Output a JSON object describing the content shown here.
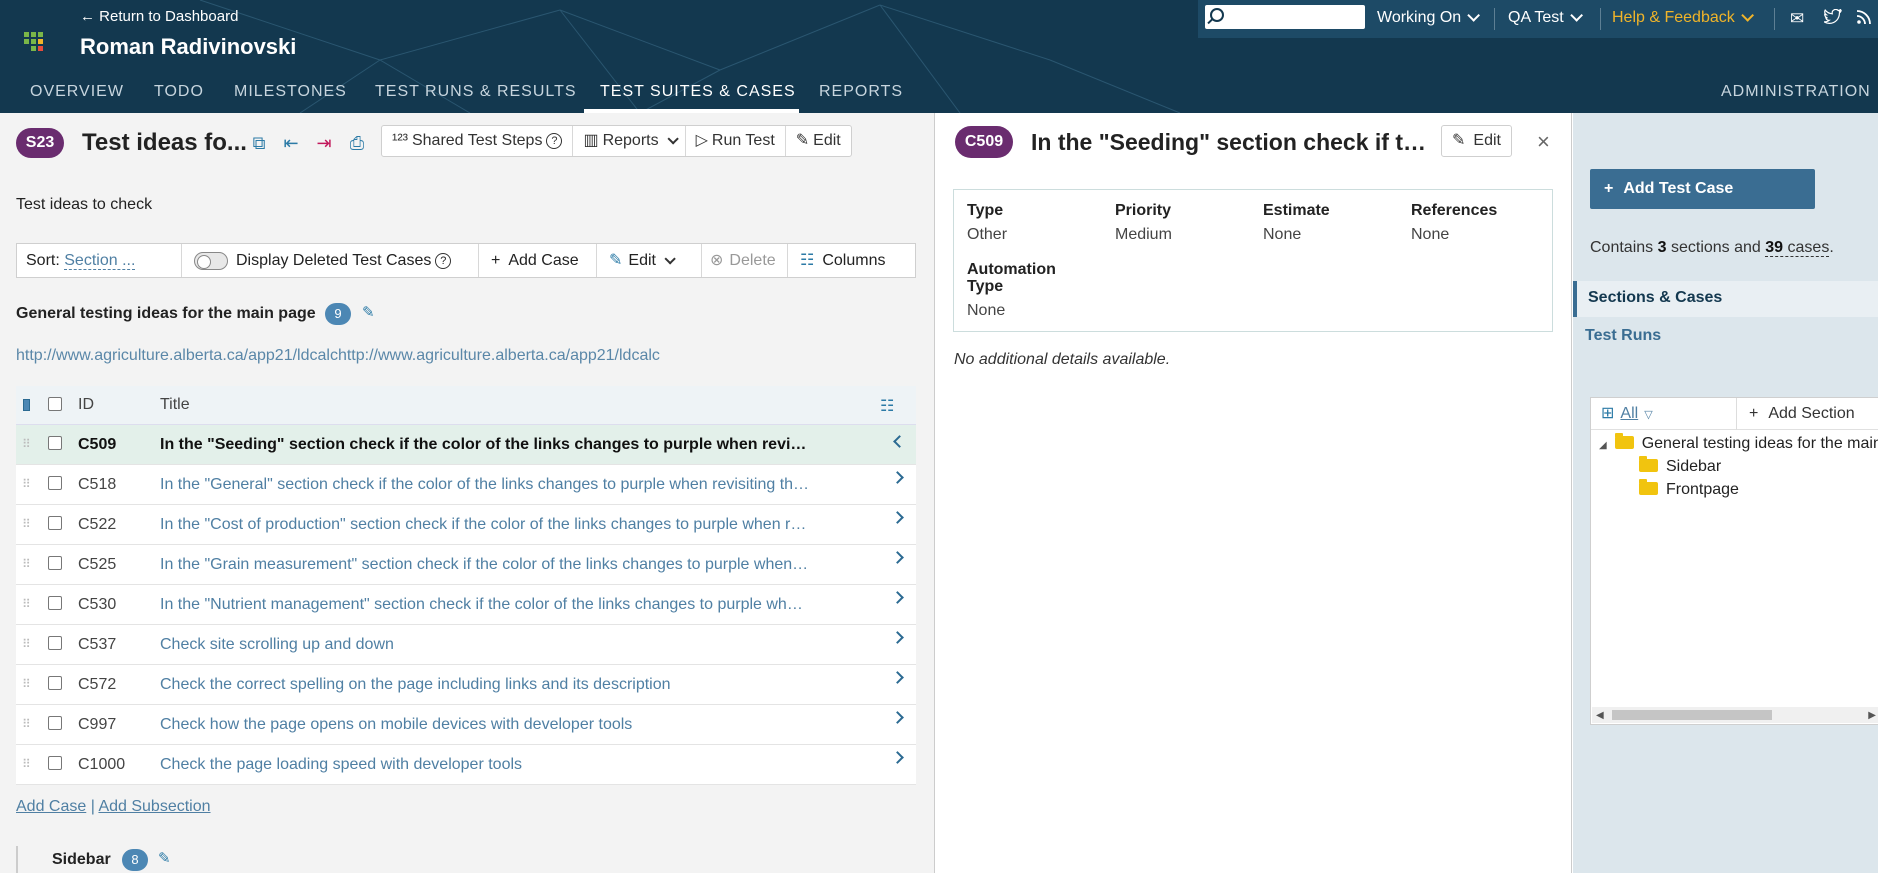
{
  "header": {
    "return_link": "← Return to Dashboard",
    "project_name": "Roman Radivinovski",
    "search_placeholder": "",
    "working_on": "Working On",
    "qa_test": "QA Test",
    "help_feedback": "Help & Feedback",
    "accent_color": "#f0b429",
    "tabs": [
      "OVERVIEW",
      "TODO",
      "MILESTONES",
      "TEST RUNS & RESULTS",
      "TEST SUITES & CASES",
      "REPORTS"
    ],
    "active_tab": "TEST SUITES & CASES",
    "administration": "ADMINISTRATION"
  },
  "suite": {
    "badge": "S23",
    "title": "Test ideas fo...",
    "shared_steps": "Shared Test Steps",
    "reports": "Reports",
    "run_test": "Run Test",
    "edit": "Edit",
    "description": "Test ideas to check",
    "sort_label": "Sort:",
    "sort_value": "Section ...",
    "display_deleted": "Display Deleted Test Cases",
    "add_case": "Add Case",
    "edit_menu": "Edit",
    "delete": "Delete",
    "columns": "Columns"
  },
  "section": {
    "name": "General testing ideas for the main page",
    "count": "9",
    "description": "http://www.agriculture.alberta.ca/app21/ldcalchttp://www.agriculture.alberta.ca/app21/ldcalc",
    "col_id": "ID",
    "col_title": "Title",
    "cases": [
      {
        "id": "C509",
        "title": "In the \"Seeding\" section check if the color of the links changes to purple when revisiting them"
      },
      {
        "id": "C518",
        "title": "In the \"General\" section check if the color of the links changes to purple when revisiting them"
      },
      {
        "id": "C522",
        "title": "In the \"Cost of production\" section check if the color of the links changes to purple when revisiting them"
      },
      {
        "id": "C525",
        "title": "In the \"Grain measurement\" section check if the color of the links changes to purple when revisiting them"
      },
      {
        "id": "C530",
        "title": "In the \"Nutrient management\" section check if the color of the links changes to purple when revisiting them"
      },
      {
        "id": "C537",
        "title": "Check site scrolling up and down"
      },
      {
        "id": "C572",
        "title": "Check the correct spelling on the page including links and its description"
      },
      {
        "id": "C997",
        "title": "Check how the page opens on mobile devices with developer tools"
      },
      {
        "id": "C1000",
        "title": "Check the page loading speed with developer tools"
      }
    ],
    "add_case_link": "Add Case",
    "separator": "|",
    "add_subsection_link": "Add Subsection"
  },
  "subsection": {
    "name": "Sidebar",
    "count": "8"
  },
  "detail": {
    "badge": "C509",
    "title": "In the \"Seeding\" section check if the ...",
    "edit": "Edit",
    "close": "×",
    "type_label": "Type",
    "type_value": "Other",
    "priority_label": "Priority",
    "priority_value": "Medium",
    "estimate_label": "Estimate",
    "estimate_value": "None",
    "references_label": "References",
    "references_value": "None",
    "automation_label": "Automation Type",
    "automation_value": "None",
    "no_details": "No additional details available."
  },
  "sidebar": {
    "add_test_case": "Add Test Case",
    "contains_prefix": "Contains",
    "sections_count": "3",
    "sections_word": "sections and",
    "cases_count": "39",
    "cases_word": "cases",
    "contains_suffix": ".",
    "sections_cases": "Sections & Cases",
    "test_runs": "Test Runs",
    "tree_filter": "All",
    "add_section": "Add Section",
    "tree": [
      "General testing ideas for the main page",
      "Sidebar",
      "Frontpage"
    ]
  }
}
